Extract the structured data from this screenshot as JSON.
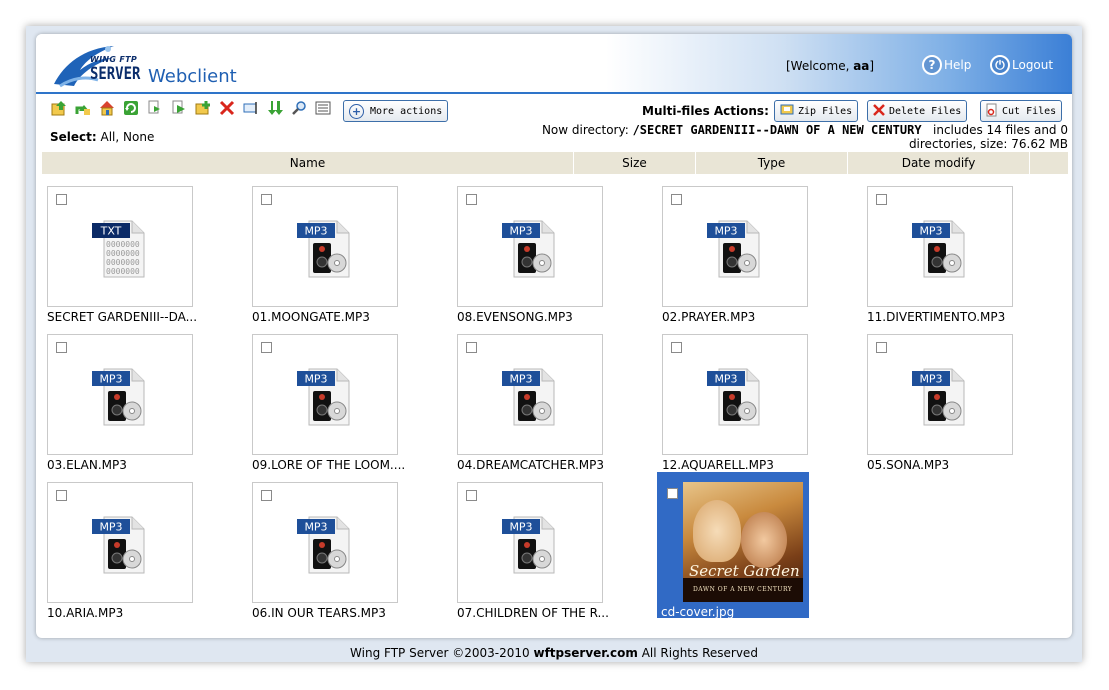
{
  "header": {
    "logo_small": "WING FTP",
    "logo_big": "SERVER",
    "app_title": "Webclient",
    "welcome_prefix": "[Welcome, ",
    "username": "aa",
    "welcome_suffix": "]",
    "help_label": "Help",
    "logout_label": "Logout"
  },
  "toolbar": {
    "icons": [
      "upload-icon",
      "go-up-icon",
      "home-icon",
      "refresh-icon",
      "copy-icon",
      "move-icon",
      "new-folder-icon",
      "delete-icon",
      "rename-icon",
      "download-icon",
      "search-icon",
      "view-mode-icon"
    ],
    "more_actions_label": "More actions",
    "multi_files_label": "Multi-files Actions:",
    "zip_label": "Zip Files",
    "delete_label": "Delete Files",
    "cut_label": "Cut Files"
  },
  "select": {
    "label": "Select:",
    "all": "All",
    "separator": ", ",
    "none": "None"
  },
  "directory": {
    "prefix": "Now directory: ",
    "path": "/SECRET GARDENIII--DAWN OF A NEW CENTURY",
    "summary_line1": "includes 14 files and 0",
    "summary_line2": "directories, size: 76.62 MB"
  },
  "columns": [
    "Name",
    "Size",
    "Type",
    "Date modify"
  ],
  "files": [
    {
      "name": "SECRET GARDENIII--DA...",
      "type": "TXT"
    },
    {
      "name": "01.MOONGATE.MP3",
      "type": "MP3"
    },
    {
      "name": "08.EVENSONG.MP3",
      "type": "MP3"
    },
    {
      "name": "02.PRAYER.MP3",
      "type": "MP3"
    },
    {
      "name": "11.DIVERTIMENTO.MP3",
      "type": "MP3"
    },
    {
      "name": "03.ELAN.MP3",
      "type": "MP3"
    },
    {
      "name": "09.LORE OF THE LOOM....",
      "type": "MP3"
    },
    {
      "name": "04.DREAMCATCHER.MP3",
      "type": "MP3"
    },
    {
      "name": "12.AQUARELL.MP3",
      "type": "MP3"
    },
    {
      "name": "05.SONA.MP3",
      "type": "MP3"
    },
    {
      "name": "10.ARIA.MP3",
      "type": "MP3"
    },
    {
      "name": "06.IN OUR TEARS.MP3",
      "type": "MP3"
    },
    {
      "name": "07.CHILDREN OF THE R...",
      "type": "MP3"
    },
    {
      "name": "cd-cover.jpg",
      "type": "JPG",
      "selected": true
    }
  ],
  "cover_art": {
    "script_title": "Secret Garden",
    "subtitle": "DAWN OF A NEW CENTURY"
  },
  "footer": {
    "prefix": "Wing FTP Server ©2003-2010 ",
    "site": "wftpserver.com",
    "suffix": " All Rights Reserved"
  },
  "colors": {
    "header_blue": "#2e74c9",
    "selection_blue": "#316ac5",
    "column_header_bg": "#e9e5d6"
  }
}
